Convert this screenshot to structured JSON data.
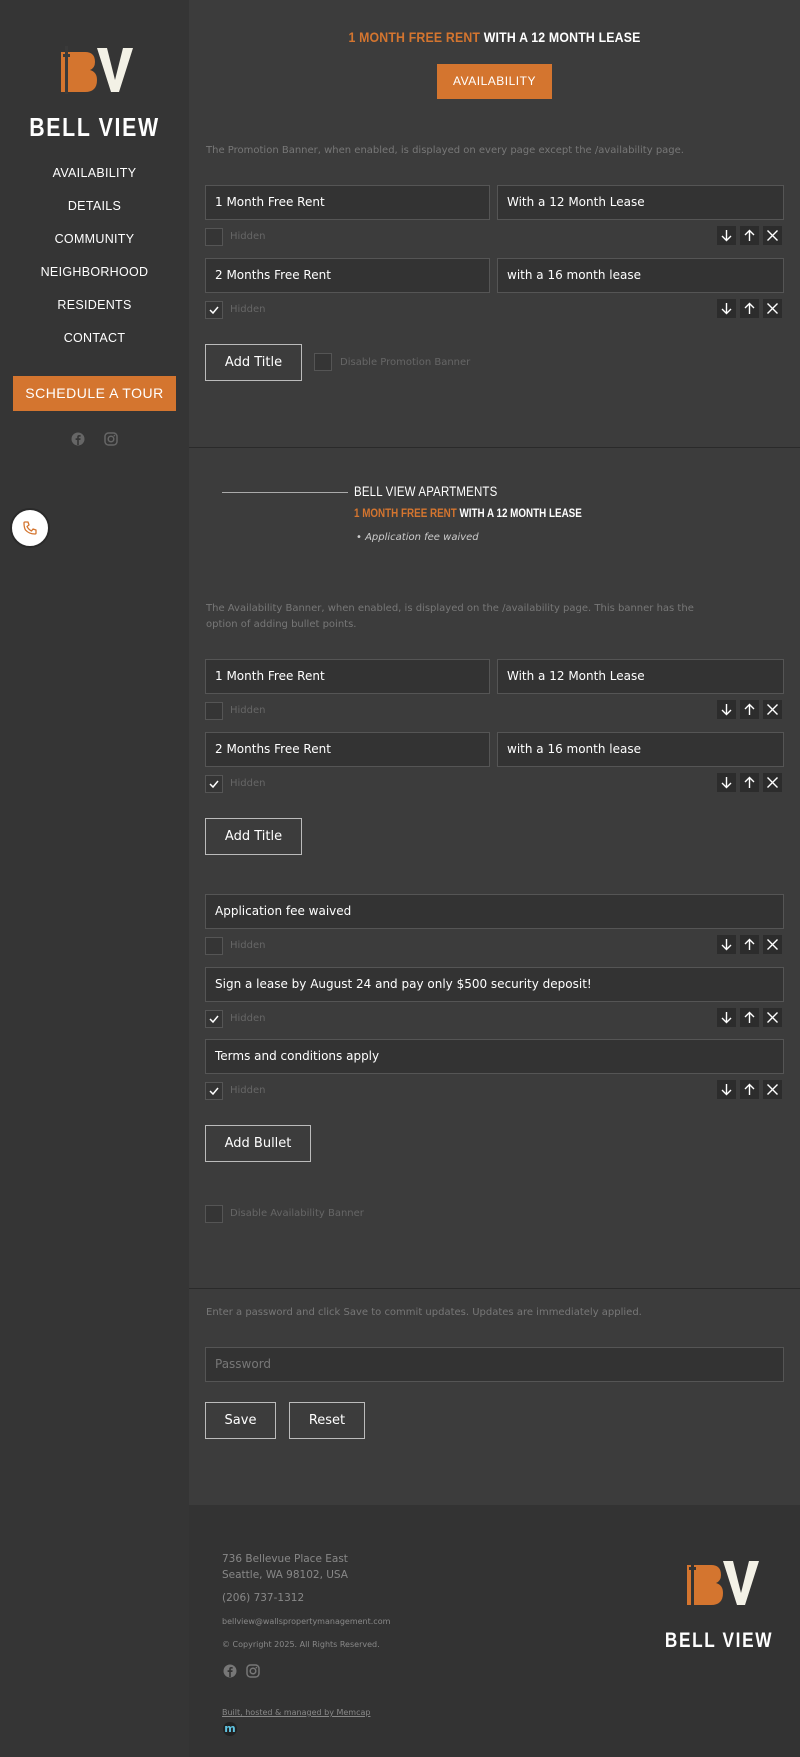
{
  "sidebar": {
    "brand": "BELL VIEW",
    "nav": [
      "AVAILABILITY",
      "DETAILS",
      "COMMUNITY",
      "NEIGHBORHOOD",
      "RESIDENTS",
      "CONTACT"
    ],
    "cta": "SCHEDULE A TOUR",
    "icons": [
      "facebook-icon",
      "instagram-icon",
      "phone-icon"
    ]
  },
  "promo_banner_preview": {
    "highlight": "1 MONTH FREE RENT",
    "text": "WITH A 12 MONTH LEASE",
    "button": "AVAILABILITY"
  },
  "promo_section": {
    "description": "The Promotion Banner, when enabled, is displayed on every page except the /availability page.",
    "titles": [
      {
        "left": "1 Month Free Rent",
        "right": "With a 12 Month Lease",
        "hidden_label": "Hidden",
        "hidden": false
      },
      {
        "left": "2 Months Free Rent",
        "right": "with a 16 month lease",
        "hidden_label": "Hidden",
        "hidden": true
      }
    ],
    "add_title": "Add Title",
    "disable_label": "Disable Promotion Banner"
  },
  "availability_preview": {
    "title": "BELL VIEW APARTMENTS",
    "highlight": "1 MONTH FREE RENT",
    "text": "WITH A 12 MONTH LEASE",
    "bullet": "Application fee waived"
  },
  "availability_section": {
    "description": "The Availability Banner, when enabled, is displayed on the /availability page. This banner has the option of adding bullet points.",
    "titles": [
      {
        "left": "1 Month Free Rent",
        "right": "With a 12 Month Lease",
        "hidden_label": "Hidden",
        "hidden": false
      },
      {
        "left": "2 Months Free Rent",
        "right": "with a 16 month lease",
        "hidden_label": "Hidden",
        "hidden": true
      }
    ],
    "add_title": "Add Title",
    "bullets": [
      {
        "text": "Application fee waived",
        "hidden_label": "Hidden",
        "hidden": false
      },
      {
        "text": "Sign a lease by August 24 and pay only $500 security deposit!",
        "hidden_label": "Hidden",
        "hidden": true
      },
      {
        "text": "Terms and conditions apply",
        "hidden_label": "Hidden",
        "hidden": true
      }
    ],
    "add_bullet": "Add Bullet",
    "disable_label": "Disable Availability Banner"
  },
  "save_section": {
    "description": "Enter a password and click Save to commit updates. Updates are immediately applied.",
    "password_placeholder": "Password",
    "save": "Save",
    "reset": "Reset"
  },
  "footer": {
    "address1": "736 Bellevue Place East",
    "address2": "Seattle, WA 98102, USA",
    "phone": "(206) 737-1312",
    "email": "bellview@wallspropertymanagement.com",
    "copyright": "© Copyright 2025. All Rights Reserved.",
    "credit": "Built, hosted & managed by Memcap",
    "brand": "BELL VIEW"
  },
  "colors": {
    "accent": "#d4752f",
    "sidebar": "#353535",
    "main": "#3c3c3c"
  }
}
